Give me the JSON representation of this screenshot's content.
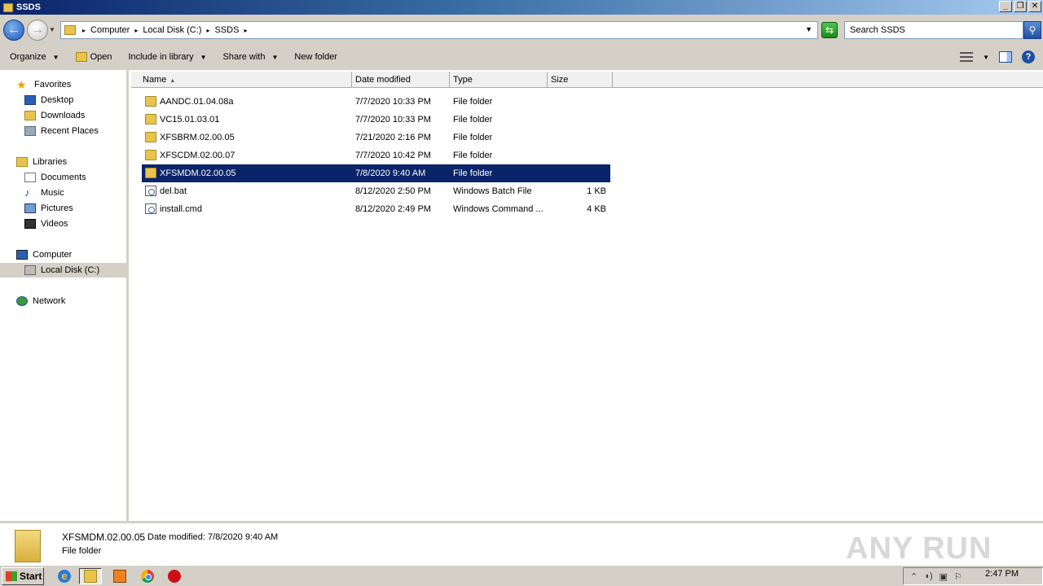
{
  "window": {
    "title": "SSDS",
    "controls": {
      "minimize": "_",
      "restore": "❐",
      "close": "✕"
    }
  },
  "address": {
    "crumbs": [
      "Computer",
      "Local Disk (C:)",
      "SSDS"
    ],
    "search_placeholder": "Search SSDS"
  },
  "toolbar": {
    "organize": "Organize",
    "open": "Open",
    "include_library": "Include in library",
    "share_with": "Share with",
    "new_folder": "New folder"
  },
  "nav": {
    "favorites": "Favorites",
    "desktop": "Desktop",
    "downloads": "Downloads",
    "recent": "Recent Places",
    "libraries": "Libraries",
    "documents": "Documents",
    "music": "Music",
    "pictures": "Pictures",
    "videos": "Videos",
    "computer": "Computer",
    "local_disk": "Local Disk (C:)",
    "network": "Network"
  },
  "columns": {
    "name": "Name",
    "date": "Date modified",
    "type": "Type",
    "size": "Size"
  },
  "files": [
    {
      "name": "AANDC.01.04.08a",
      "date": "7/7/2020 10:33 PM",
      "type": "File folder",
      "size": "",
      "icon": "folder-icon"
    },
    {
      "name": "VC15.01.03.01",
      "date": "7/7/2020 10:33 PM",
      "type": "File folder",
      "size": "",
      "icon": "folder-icon"
    },
    {
      "name": "XFSBRM.02.00.05",
      "date": "7/21/2020 2:16 PM",
      "type": "File folder",
      "size": "",
      "icon": "folder-icon"
    },
    {
      "name": "XFSCDM.02.00.07",
      "date": "7/7/2020 10:42 PM",
      "type": "File folder",
      "size": "",
      "icon": "folder-icon"
    },
    {
      "name": "XFSMDM.02.00.05",
      "date": "7/8/2020 9:40 AM",
      "type": "File folder",
      "size": "",
      "icon": "folder-icon",
      "selected": true
    },
    {
      "name": "del.bat",
      "date": "8/12/2020 2:50 PM",
      "type": "Windows Batch File",
      "size": "1 KB",
      "icon": "script-icon"
    },
    {
      "name": "install.cmd",
      "date": "8/12/2020 2:49 PM",
      "type": "Windows Command ...",
      "size": "4 KB",
      "icon": "script-icon"
    }
  ],
  "details": {
    "name": "XFSMDM.02.00.05",
    "modified": "Date modified: 7/8/2020 9:40 AM",
    "type": "File folder",
    "watermark": "ANY RUN"
  },
  "taskbar": {
    "start": "Start",
    "clock": "2:47 PM"
  },
  "colors": {
    "selection": "#0a246a",
    "chrome": "#d4d0c8"
  }
}
